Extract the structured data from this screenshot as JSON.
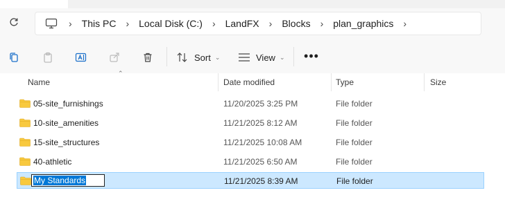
{
  "breadcrumb": [
    "This PC",
    "Local Disk (C:)",
    "LandFX",
    "Blocks",
    "plan_graphics"
  ],
  "toolbar": {
    "sort_label": "Sort",
    "view_label": "View",
    "icons": [
      "copy-icon",
      "paste-icon",
      "rename-icon",
      "share-icon",
      "delete-icon",
      "sort-icon",
      "view-icon",
      "more-icon"
    ]
  },
  "columns": {
    "name": "Name",
    "date_modified": "Date modified",
    "type": "Type",
    "size": "Size"
  },
  "files": [
    {
      "name": "05-site_furnishings",
      "date": "11/20/2025 3:25 PM",
      "type": "File folder"
    },
    {
      "name": "10-site_amenities",
      "date": "11/21/2025 8:12 AM",
      "type": "File folder"
    },
    {
      "name": "15-site_structures",
      "date": "11/21/2025 10:08 AM",
      "type": "File folder"
    },
    {
      "name": "40-athletic",
      "date": "11/21/2025 6:50 AM",
      "type": "File folder"
    },
    {
      "name": "My Standards",
      "date": "11/21/2025 8:39 AM",
      "type": "File folder"
    }
  ],
  "colors": {
    "selection_bg": "#cce8ff",
    "selection_border": "#99d1ff",
    "text_selection": "#0078d7",
    "folder_yellow": "#f8c93e"
  }
}
